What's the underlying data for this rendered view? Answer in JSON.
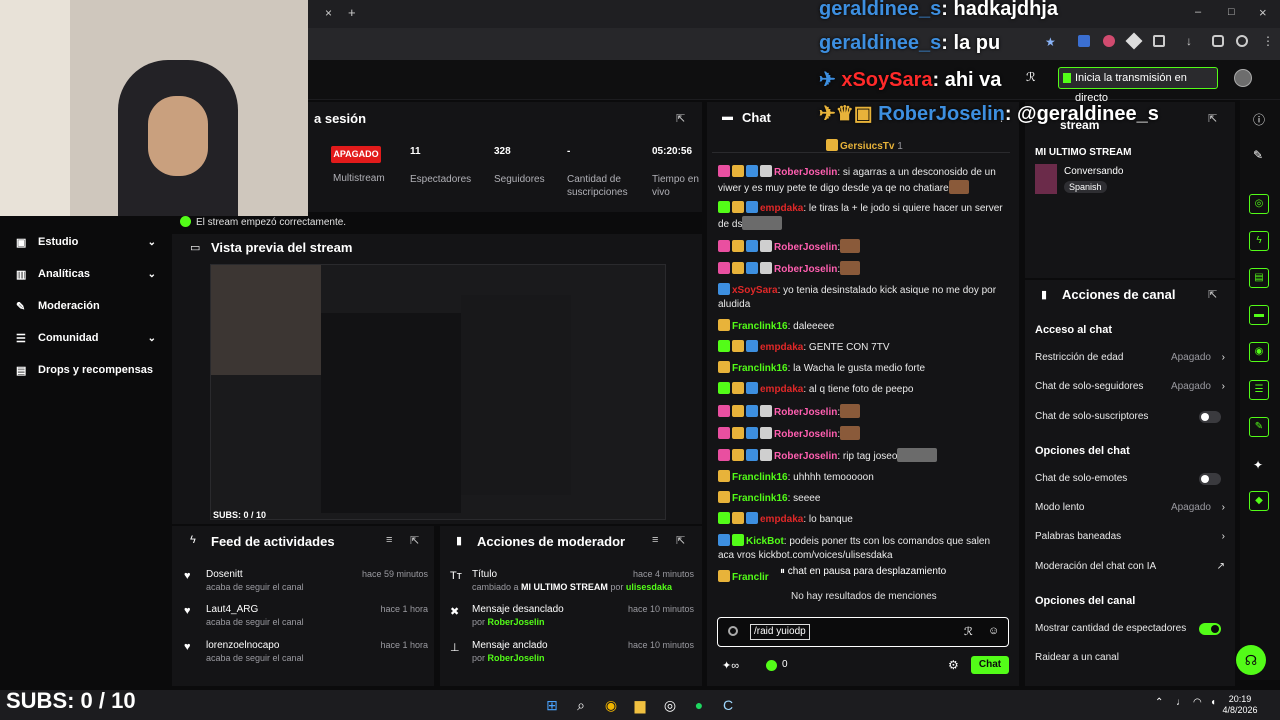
{
  "browser": {
    "tab_close": "×",
    "tab_add": "+",
    "win_min": "–",
    "win_max": "□",
    "win_close": "×"
  },
  "header": {
    "golive_label": "Inicia la transmisión en directo"
  },
  "overlay_chat": [
    {
      "user": "geraldinee_s",
      "text": ": hadkajdhja"
    },
    {
      "user": "geraldinee_s",
      "text": ": la pu"
    },
    {
      "user": "xSoySara",
      "text": ": ahi va"
    },
    {
      "user": "RoberJoselin",
      "text": ": @geraldinee_s"
    }
  ],
  "session": {
    "title_fragment": "a sesión",
    "status": "APAGADO",
    "multistream": "Multistream",
    "viewers_value": "11",
    "viewers_label": "Espectadores",
    "followers_value": "328",
    "followers_label": "Seguidores",
    "subs_value": "-",
    "subs_label": "Cantidad de suscripciones",
    "time_value": "05:20:56",
    "time_label": "Tiempo en vivo"
  },
  "toast": "El stream empezó correctamente.",
  "sidebar": {
    "items": [
      {
        "label": "Estudio"
      },
      {
        "label": "Analíticas"
      },
      {
        "label": "Moderación"
      },
      {
        "label": "Comunidad"
      },
      {
        "label": "Drops y recompensas"
      }
    ]
  },
  "preview": {
    "title": "Vista previa del stream",
    "subs_overlay": "SUBS: 0 / 10"
  },
  "feed": {
    "title": "Feed de actividades",
    "items": [
      {
        "name": "Dosenitt",
        "sub": "acaba de seguir el canal",
        "time": "hace 59 minutos"
      },
      {
        "name": "Laut4_ARG",
        "sub": "acaba de seguir el canal",
        "time": "hace 1 hora"
      },
      {
        "name": "lorenzoelnocapo",
        "sub": "acaba de seguir el canal",
        "time": "hace 1 hora"
      }
    ]
  },
  "modactions": {
    "title": "Acciones de moderador",
    "items": [
      {
        "name": "Título",
        "pre": "cambiado a",
        "bold": "MI ULTIMO STREAM",
        "mid": "por",
        "user": "ulisesdaka",
        "time": "hace 4 minutos"
      },
      {
        "name": "Mensaje desanclado",
        "pre": "por",
        "bold": "",
        "mid": "",
        "user": "RoberJoselin",
        "time": "hace 10 minutos"
      },
      {
        "name": "Mensaje anclado",
        "pre": "por",
        "bold": "",
        "mid": "",
        "user": "RoberJoselin",
        "time": "hace 10 minutos"
      }
    ]
  },
  "chat": {
    "title": "Chat",
    "pinned_user": "GersiucsTv",
    "pinned_count": "1",
    "paused": "chat en pausa para desplazamiento",
    "no_mentions": "No hay resultados de menciones",
    "input_value": "/raid yuiodp",
    "points": "0",
    "send": "Chat",
    "messages": [
      {
        "user": "RoberJoselin",
        "cls": "u-pink",
        "text": ": si agarras a un desconosido de un viwer y es muy pete te digo desde ya qe no chatiare"
      },
      {
        "user": "empdaka",
        "cls": "u-red",
        "text": ": le tiras la  + le jodo si quiere hacer un server de ds"
      },
      {
        "user": "RoberJoselin",
        "cls": "u-pink",
        "text": ":"
      },
      {
        "user": "RoberJoselin",
        "cls": "u-pink",
        "text": ":"
      },
      {
        "user": "xSoySara",
        "cls": "u-red",
        "text": ": yo tenia desinstalado kick asique no me doy por aludida"
      },
      {
        "user": "Franclink16",
        "cls": "u-green",
        "text": ": daleeeee"
      },
      {
        "user": "empdaka",
        "cls": "u-red",
        "text": ": GENTE CON 7TV"
      },
      {
        "user": "Franclink16",
        "cls": "u-green",
        "text": ": la Wacha le gusta medio forte"
      },
      {
        "user": "empdaka",
        "cls": "u-red",
        "text": ": al q tiene foto de peepo"
      },
      {
        "user": "RoberJoselin",
        "cls": "u-pink",
        "text": ":"
      },
      {
        "user": "RoberJoselin",
        "cls": "u-pink",
        "text": ":"
      },
      {
        "user": "RoberJoselin",
        "cls": "u-pink",
        "text": ": rip tag joseo"
      },
      {
        "user": "Franclink16",
        "cls": "u-green",
        "text": ": uhhhh temooooon"
      },
      {
        "user": "Franclink16",
        "cls": "u-green",
        "text": ": seeee"
      },
      {
        "user": "empdaka",
        "cls": "u-red",
        "text": ": lo banque"
      },
      {
        "user": "KickBot",
        "cls": "u-green",
        "text": ": podeis poner tts con los comandos que salen aca vros  kickbot.com/voices/ulisesdaka"
      },
      {
        "user": "Franclir",
        "cls": "u-green",
        "text": ""
      }
    ]
  },
  "stream_info": {
    "title_fragment": "stream",
    "stream_title": "MI ULTIMO STREAM",
    "category": "Conversando",
    "language": "Spanish"
  },
  "channel_actions": {
    "title": "Acciones de canal",
    "chat_access": "Acceso al chat",
    "age": "Restricción de edad",
    "age_val": "Apagado",
    "followers_only": "Chat de solo-seguidores",
    "followers_val": "Apagado",
    "subs_only": "Chat de solo-suscriptores",
    "chat_options": "Opciones del chat",
    "emotes_only": "Chat de solo-emotes",
    "slow": "Modo lento",
    "slow_val": "Apagado",
    "banned": "Palabras baneadas",
    "ai_mod": "Moderación del chat con IA",
    "channel_options": "Opciones del canal",
    "show_viewers": "Mostrar cantidad de espectadores",
    "raid": "Raidear a un canal"
  },
  "bottom_overlay": "SUBS: 0 / 10",
  "taskbar": {
    "time": "20:19",
    "date": "4/8/2026"
  }
}
